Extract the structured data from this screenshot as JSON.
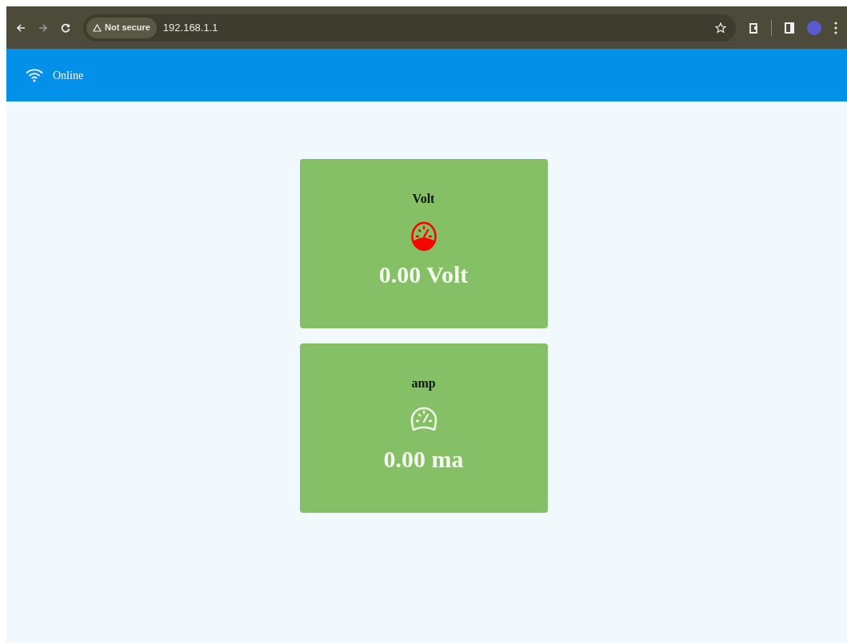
{
  "browser": {
    "security": "Not secure",
    "url": "192.168.1.1"
  },
  "header": {
    "status": "Online"
  },
  "cards": [
    {
      "title": "Volt",
      "reading": "0.00 Volt",
      "kind": "filled",
      "color": "#ff0000"
    },
    {
      "title": "amp",
      "reading": "0.00 ma",
      "kind": "outline",
      "color": "#eef7e4"
    }
  ]
}
